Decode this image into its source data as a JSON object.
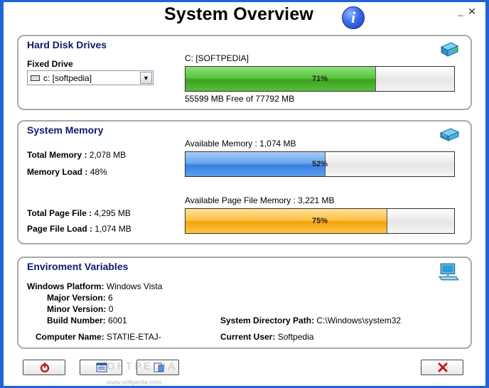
{
  "window": {
    "title": "System Overview",
    "info_glyph": "i",
    "minimize_glyph": "_",
    "close_glyph": "✕"
  },
  "hard_disk": {
    "title": "Hard Disk Drives",
    "fixed_drive_label": "Fixed Drive",
    "selected_drive": "c: [softpedia]",
    "drive_name": "C: [SOFTPEDIA]",
    "usage_percent": 71,
    "usage_label": "71%",
    "free_text": "55599 MB Free of 77792 MB",
    "icon": "hard-drive-icon",
    "bar_color": "#4cbf2f"
  },
  "memory": {
    "title": "System Memory",
    "total_memory_label": "Total Memory :",
    "total_memory_value": "2,078  MB",
    "memory_load_label": "Memory Load :",
    "memory_load_value": "48%",
    "available_memory_label": "Available Memory :  1,074  MB",
    "memory_bar_percent": 52,
    "memory_bar_label": "52%",
    "total_page_label": "Total Page File :",
    "total_page_value": "4,295  MB",
    "page_load_label": "Page File Load :",
    "page_load_value": "1,074  MB",
    "available_page_label": "Available Page File Memory : 3,221  MB",
    "page_bar_percent": 75,
    "page_bar_label": "75%",
    "icon": "memory-chip-icon",
    "memory_bar_color": "#3a7fe0",
    "page_bar_color": "#f5a40b"
  },
  "environment": {
    "title": "Enviroment Variables",
    "platform_label": "Windows Platform:",
    "platform_value": "Windows Vista",
    "major_label": "Major Version:",
    "major_value": "6",
    "minor_label": "Minor Version:",
    "minor_value": "0",
    "build_label": "Build Number:",
    "build_value": "6001",
    "sysdir_label": "System Directory Path:",
    "sysdir_value": "C:\\Windows\\system32",
    "computer_label": "Computer Name:",
    "computer_value": "STATIE-ETAJ-",
    "user_label": "Current User:",
    "user_value": "Softpedia",
    "icon": "computer-monitor-icon"
  },
  "footer": {
    "watermark": "SOFTPEDIA",
    "watermark_url": "www.softpedia.com",
    "buttons": [
      "power-icon",
      "system-info-icon",
      "export-icon",
      "close-icon"
    ]
  }
}
